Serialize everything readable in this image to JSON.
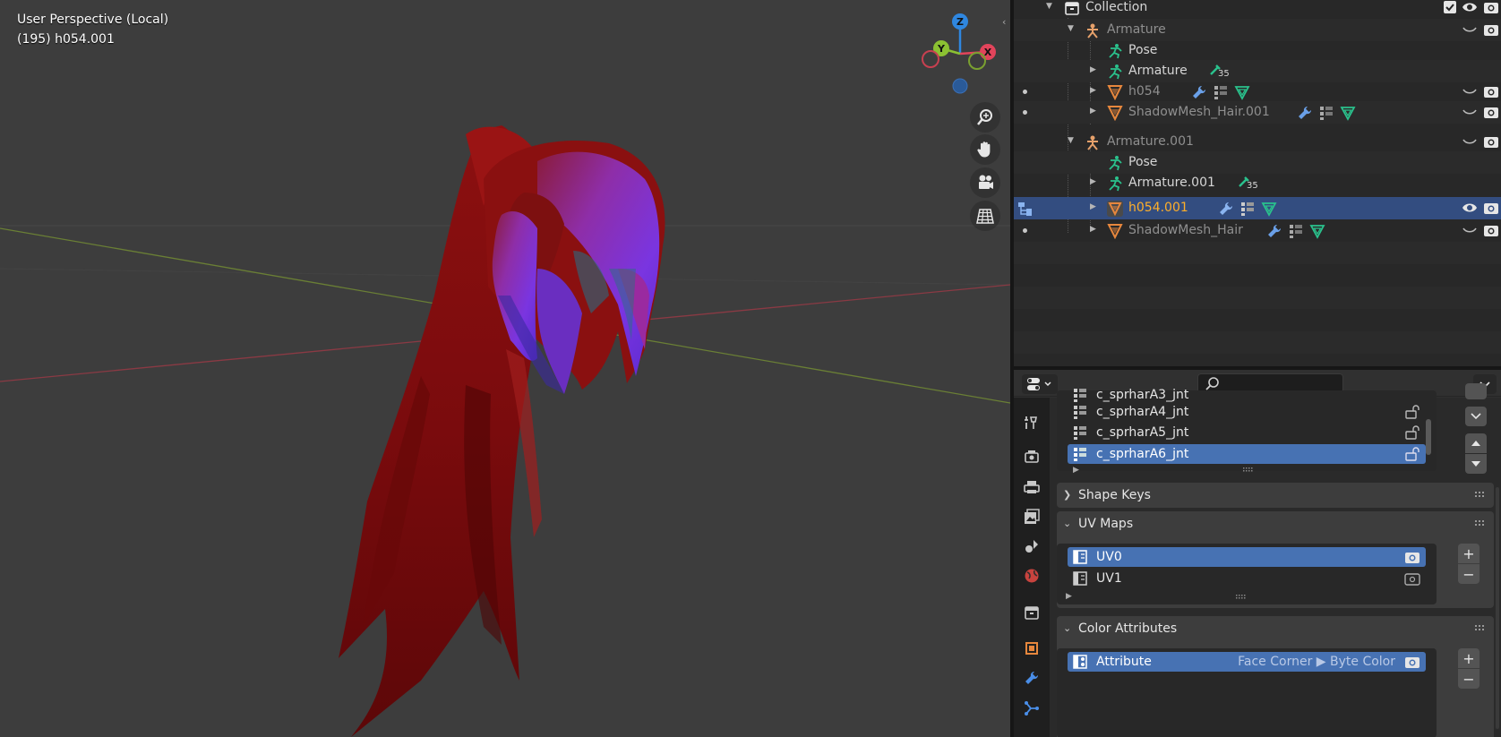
{
  "viewport": {
    "view_name": "User Perspective (Local)",
    "frame_object": "(195) h054.001",
    "gizmo": {
      "z": "Z",
      "y": "Y",
      "x": "X"
    },
    "nav_icons": [
      "zoom-icon",
      "pan-hand-icon",
      "camera-icon",
      "grid-icon"
    ]
  },
  "outliner": {
    "rows": [
      {
        "label": "Collection"
      },
      {
        "label": "Armature"
      },
      {
        "label": "Pose"
      },
      {
        "label": "Armature",
        "badge": "35"
      },
      {
        "label": "h054"
      },
      {
        "label": "ShadowMesh_Hair.001"
      },
      {
        "label": "Armature.001"
      },
      {
        "label": "Pose"
      },
      {
        "label": "Armature.001",
        "badge": "35"
      },
      {
        "label": "h054.001"
      },
      {
        "label": "ShadowMesh_Hair"
      }
    ]
  },
  "properties": {
    "search": {
      "placeholder": ""
    },
    "vertex_groups": [
      {
        "label": "c_sprharA3_jnt"
      },
      {
        "label": "c_sprharA4_jnt"
      },
      {
        "label": "c_sprharA5_jnt"
      },
      {
        "label": "c_sprharA6_jnt"
      }
    ],
    "panels": {
      "shape_keys": "Shape Keys",
      "uv_maps": "UV Maps",
      "color_attributes": "Color Attributes"
    },
    "uv_maps": [
      {
        "label": "UV0"
      },
      {
        "label": "UV1"
      }
    ],
    "color_attributes": [
      {
        "label": "Attribute",
        "domain": "Face Corner",
        "type": "Byte Color"
      }
    ],
    "side_buttons": {
      "add": "+",
      "remove": "−"
    }
  },
  "colors": {
    "accent": "#4772b3",
    "selected_row": "#334d80",
    "active_text": "#ffaf29",
    "axis_x": "#e2445b",
    "axis_y": "#8bc132",
    "axis_z": "#2f87e0",
    "mesh_icon": "#e7873d",
    "armature_icon": "#e6a16b",
    "pose_icon": "#2ac28d"
  }
}
